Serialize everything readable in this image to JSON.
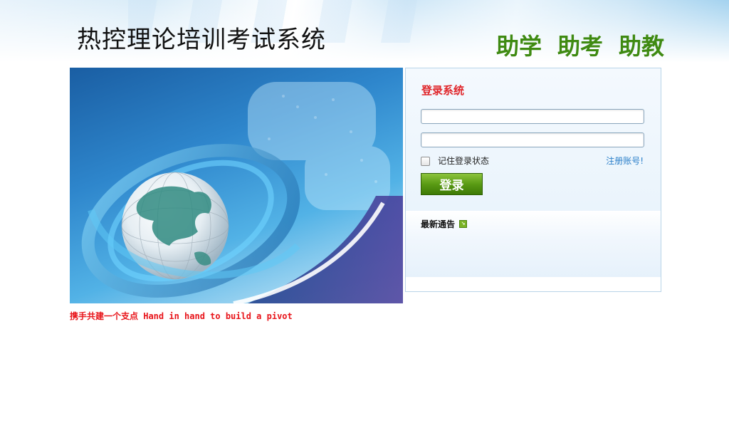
{
  "header": {
    "title": "热控理论培训考试系统",
    "slogans": [
      "助学",
      "助考",
      "助教"
    ]
  },
  "banner": {
    "tagline": "携手共建一个支点 Hand in hand to build a pivot"
  },
  "login": {
    "title": "登录系统",
    "username_value": "",
    "password_value": "",
    "remember_label": "记住登录状态",
    "remember_checked": false,
    "register_link": "注册账号!",
    "submit_label": "登录"
  },
  "notice": {
    "title": "最新通告"
  },
  "colors": {
    "slogan_green": "#3f8a12",
    "login_title_red": "#e0262b",
    "tagline_red": "#e8141a",
    "button_green": "#5a9b14",
    "link_blue": "#2a7fc9"
  },
  "icons": {
    "notice": "arrow-square-icon",
    "banner": "globe-illustration"
  }
}
